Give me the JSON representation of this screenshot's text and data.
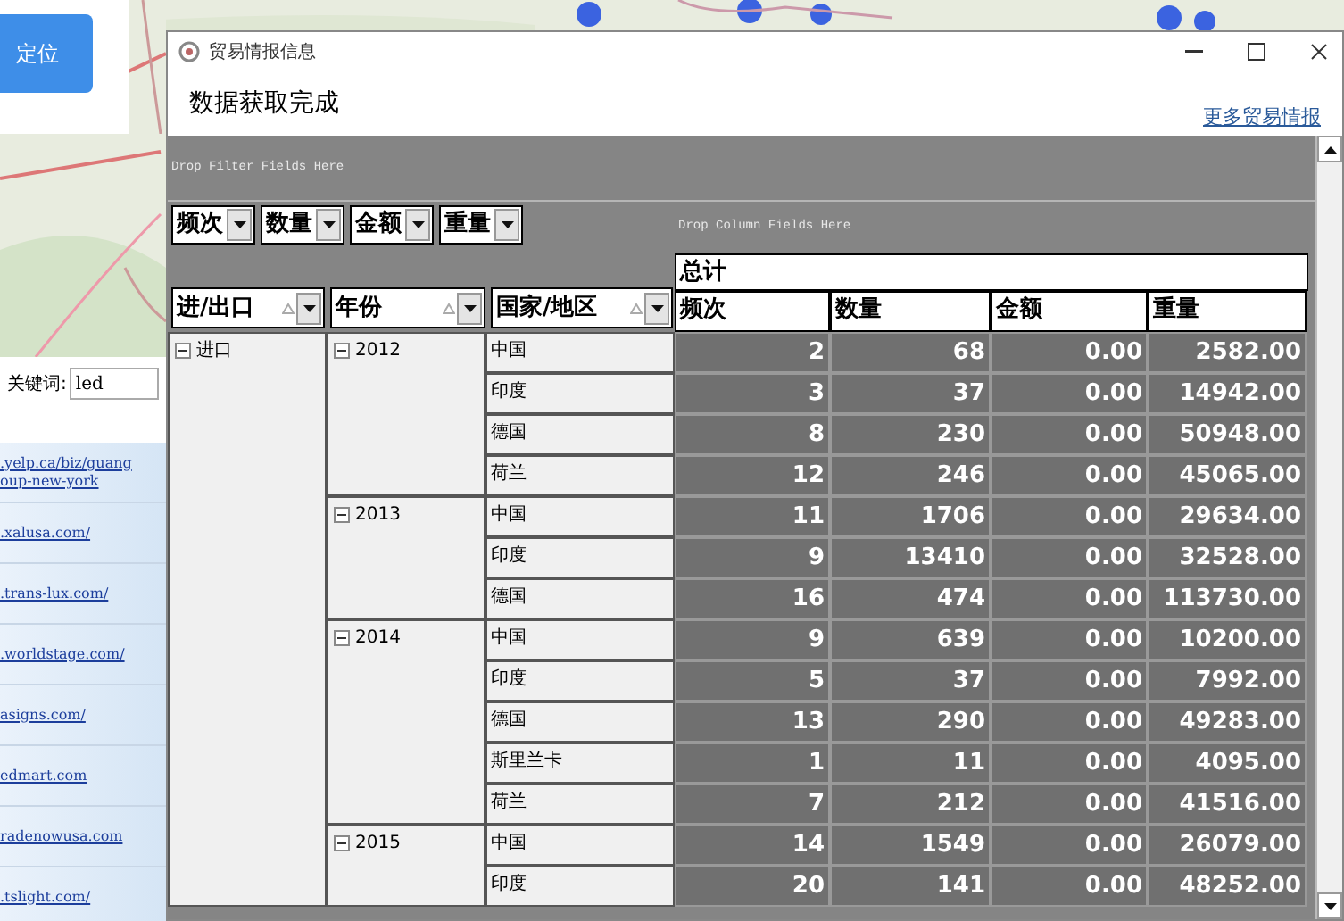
{
  "locate_button": {
    "label": "定位"
  },
  "keyword": {
    "label": "关键词:",
    "value": "led"
  },
  "links": [
    {
      "lines": [
        ".yelp.ca/biz/guang",
        "oup-new-york"
      ]
    },
    {
      "lines": [
        ".xalusa.com/"
      ]
    },
    {
      "lines": [
        ".trans-lux.com/"
      ]
    },
    {
      "lines": [
        ".worldstage.com/"
      ]
    },
    {
      "lines": [
        "asigns.com/"
      ]
    },
    {
      "lines": [
        "edmart.com"
      ]
    },
    {
      "lines": [
        "radenowusa.com"
      ]
    },
    {
      "lines": [
        ".tslight.com/"
      ]
    }
  ],
  "window": {
    "title": "贸易情报信息",
    "heading": "数据获取完成",
    "more_link": "更多贸易情报"
  },
  "pivot": {
    "filter_zone": "Drop Filter Fields Here",
    "column_zone": "Drop Column Fields Here",
    "data_fields": [
      "频次",
      "数量",
      "金额",
      "重量"
    ],
    "row_fields": [
      "进/出口",
      "年份",
      "国家/地区"
    ],
    "total_header": "总计",
    "measures": [
      "频次",
      "数量",
      "金额",
      "重量"
    ],
    "groups": [
      {
        "label": "进口",
        "expanded": true,
        "years": [
          {
            "label": "2012",
            "expanded": true,
            "rows": [
              {
                "country": "中国",
                "values": [
                  "2",
                  "68",
                  "0.00",
                  "2582.00"
                ]
              },
              {
                "country": "印度",
                "values": [
                  "3",
                  "37",
                  "0.00",
                  "14942.00"
                ]
              },
              {
                "country": "德国",
                "values": [
                  "8",
                  "230",
                  "0.00",
                  "50948.00"
                ]
              },
              {
                "country": "荷兰",
                "values": [
                  "12",
                  "246",
                  "0.00",
                  "45065.00"
                ]
              }
            ]
          },
          {
            "label": "2013",
            "expanded": true,
            "rows": [
              {
                "country": "中国",
                "values": [
                  "11",
                  "1706",
                  "0.00",
                  "29634.00"
                ]
              },
              {
                "country": "印度",
                "values": [
                  "9",
                  "13410",
                  "0.00",
                  "32528.00"
                ]
              },
              {
                "country": "德国",
                "values": [
                  "16",
                  "474",
                  "0.00",
                  "113730.00"
                ]
              }
            ]
          },
          {
            "label": "2014",
            "expanded": true,
            "rows": [
              {
                "country": "中国",
                "values": [
                  "9",
                  "639",
                  "0.00",
                  "10200.00"
                ]
              },
              {
                "country": "印度",
                "values": [
                  "5",
                  "37",
                  "0.00",
                  "7992.00"
                ]
              },
              {
                "country": "德国",
                "values": [
                  "13",
                  "290",
                  "0.00",
                  "49283.00"
                ]
              },
              {
                "country": "斯里兰卡",
                "values": [
                  "1",
                  "11",
                  "0.00",
                  "4095.00"
                ]
              },
              {
                "country": "荷兰",
                "values": [
                  "7",
                  "212",
                  "0.00",
                  "41516.00"
                ]
              }
            ]
          },
          {
            "label": "2015",
            "expanded": true,
            "rows": [
              {
                "country": "中国",
                "values": [
                  "14",
                  "1549",
                  "0.00",
                  "26079.00"
                ]
              },
              {
                "country": "印度",
                "values": [
                  "20",
                  "141",
                  "0.00",
                  "48252.00"
                ]
              }
            ]
          }
        ]
      }
    ]
  }
}
